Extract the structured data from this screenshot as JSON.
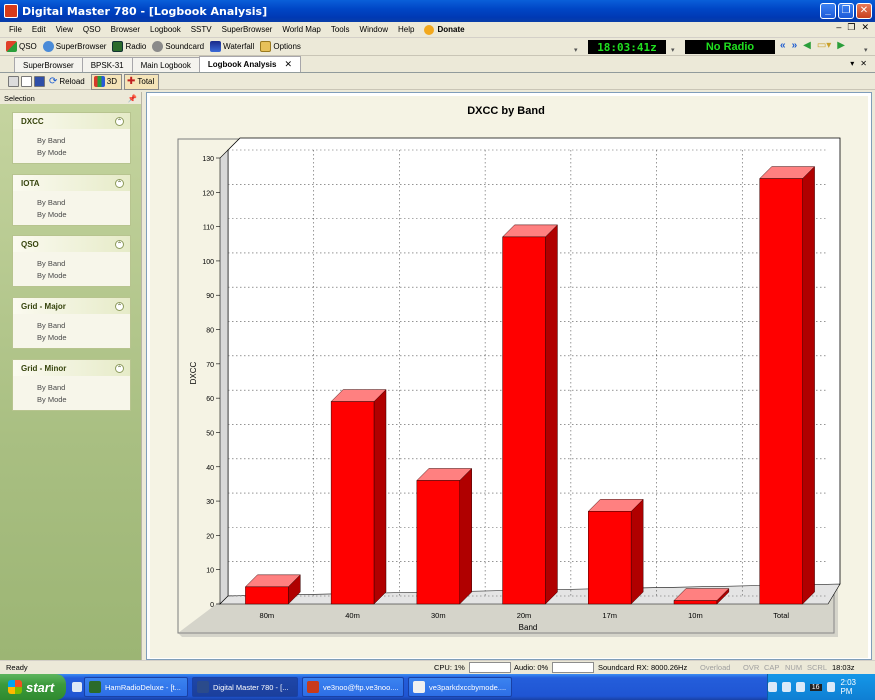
{
  "window": {
    "title": "Digital Master 780 - [Logbook Analysis]"
  },
  "menu": [
    "File",
    "Edit",
    "View",
    "QSO",
    "Browser",
    "Logbook",
    "SSTV",
    "SuperBrowser",
    "World Map",
    "Tools",
    "Window",
    "Help"
  ],
  "menu_donate": "Donate",
  "toolbar": {
    "qso": "QSO",
    "superbrowser": "SuperBrowser",
    "radio": "Radio",
    "soundcard": "Soundcard",
    "waterfall": "Waterfall",
    "options": "Options",
    "clock": "18:03:41z",
    "radio_status": "No Radio"
  },
  "tabs": [
    {
      "label": "SuperBrowser"
    },
    {
      "label": "BPSK-31"
    },
    {
      "label": "Main Logbook"
    },
    {
      "label": "Logbook Analysis"
    }
  ],
  "subtoolbar": {
    "reload": "Reload",
    "three_d": "3D",
    "total": "Total"
  },
  "selection": {
    "header": "Selection",
    "groups": [
      {
        "title": "DXCC",
        "items": [
          "By Band",
          "By Mode"
        ]
      },
      {
        "title": "IOTA",
        "items": [
          "By Band",
          "By Mode"
        ]
      },
      {
        "title": "QSO",
        "items": [
          "By Band",
          "By Mode"
        ]
      },
      {
        "title": "Grid - Major",
        "items": [
          "By Band",
          "By Mode"
        ]
      },
      {
        "title": "Grid - Minor",
        "items": [
          "By Band",
          "By Mode"
        ]
      }
    ]
  },
  "chart_data": {
    "type": "bar",
    "title": "DXCC by Band",
    "xlabel": "Band",
    "ylabel": "DXCC",
    "categories": [
      "80m",
      "40m",
      "30m",
      "20m",
      "17m",
      "10m",
      "Total"
    ],
    "values": [
      5,
      59,
      36,
      107,
      27,
      1,
      124
    ],
    "ylim": [
      0,
      130
    ],
    "yticks": [
      0,
      10,
      20,
      30,
      40,
      50,
      60,
      70,
      80,
      90,
      100,
      110,
      120,
      130
    ],
    "grid": true,
    "style": "3d",
    "color": "#ff0000"
  },
  "status": {
    "ready": "Ready",
    "cpu": "CPU: 1%",
    "audio": "Audio: 0%",
    "soundcard": "Soundcard RX: 8000.26Hz",
    "overload": "Overload",
    "ovr": "OVR",
    "cap": "CAP",
    "num": "NUM",
    "scrl": "SCRL",
    "time": "18:03z"
  },
  "taskbar": {
    "start": "start",
    "tasks": [
      "HamRadioDeluxe - [t...",
      "Digital Master 780 - [...",
      "ve3noo@ftp.ve3noo....",
      "ve3parkdxccbymode...."
    ],
    "tray_badge": "16",
    "clock": "2:03 PM"
  }
}
